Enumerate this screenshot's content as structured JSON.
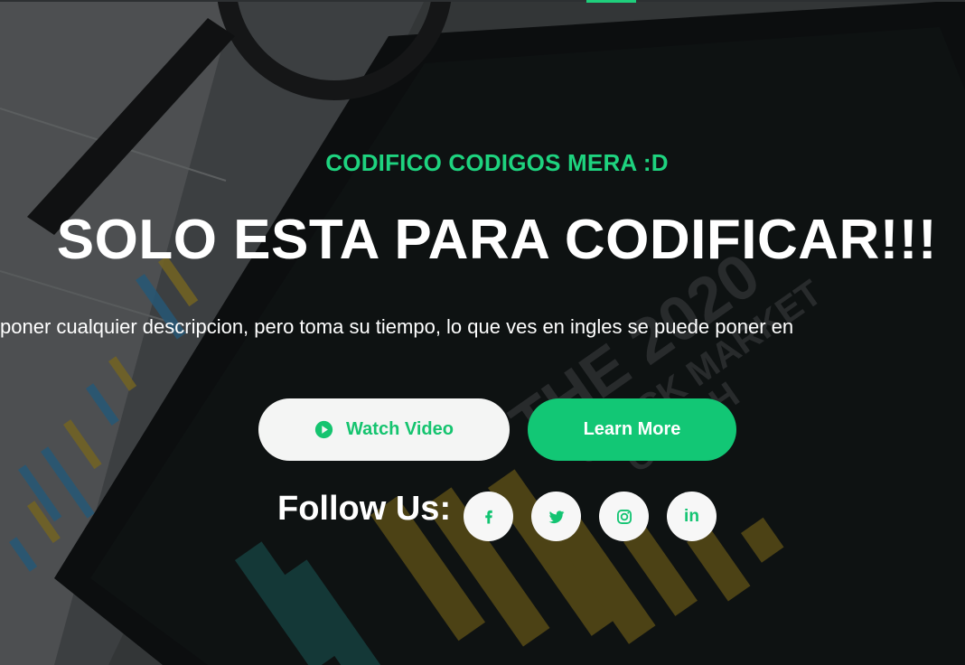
{
  "hero": {
    "subtitle": "CODIFICO CODIGOS MERA :D",
    "title": "SOLO ESTA PARA CODIFICAR!!!",
    "description": "poner cualquier descripcion, pero toma su tiempo, lo que ves en ingles se puede poner en",
    "background_image": "stock-market-crash-2020-tablet-with-magnifier",
    "background_text": {
      "year": "2020",
      "line1": "STOCK MARKET",
      "line2": "CRASH",
      "prefix": "THE"
    }
  },
  "buttons": {
    "watch_video": {
      "label": "Watch Video",
      "icon": "play-circle-icon"
    },
    "learn_more": {
      "label": "Learn More"
    }
  },
  "social": {
    "label": "Follow Us:",
    "links": [
      {
        "name": "facebook",
        "icon": "facebook-icon"
      },
      {
        "name": "twitter",
        "icon": "twitter-icon"
      },
      {
        "name": "instagram",
        "icon": "instagram-icon"
      },
      {
        "name": "linkedin",
        "icon": "linkedin-icon",
        "text": "in"
      }
    ]
  },
  "colors": {
    "accent": "#1ed37f",
    "button_primary": "#12c775",
    "button_light": "#f4f5f4",
    "text_light": "#ffffff"
  }
}
